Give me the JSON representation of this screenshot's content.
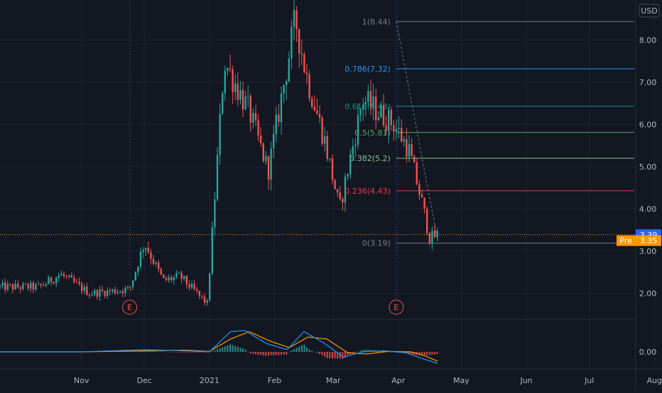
{
  "colors": {
    "background": "#131722",
    "axis_text": "#b2b5be",
    "grid": "#1f2330",
    "up": "#26a69a",
    "down": "#ef5350",
    "macd_line": "#2196f3",
    "signal_line": "#ff9800",
    "last_price_label": "#2962ff",
    "premarket_label": "#ff9800",
    "event_marker": "#ef5350"
  },
  "chart_data": [
    {
      "type": "candlestick",
      "title": "",
      "currency": "USD",
      "x_tick_labels": [
        "Nov",
        "Dec",
        "2021",
        "Feb",
        "Mar",
        "Apr",
        "May",
        "Jun",
        "Jul",
        "Aug"
      ],
      "y_tick_labels": [
        "2.00",
        "3.00",
        "4.00",
        "5.00",
        "6.00",
        "7.00",
        "8.00"
      ],
      "ylim": [
        1.35,
        8.85
      ],
      "grid": true,
      "ohlc_key_points": [
        {
          "date": "2020-10-12",
          "close": 2.15
        },
        {
          "date": "2020-10-22",
          "close": 2.45
        },
        {
          "date": "2020-11-05",
          "close": 2.0
        },
        {
          "date": "2020-11-24",
          "close": 2.1
        },
        {
          "date": "2020-12-01",
          "close": 3.2
        },
        {
          "date": "2020-12-10",
          "close": 2.3
        },
        {
          "date": "2020-12-18",
          "close": 2.4
        },
        {
          "date": "2020-12-31",
          "close": 1.75
        },
        {
          "date": "2021-01-08",
          "close": 7.5
        },
        {
          "date": "2021-01-20",
          "close": 6.3
        },
        {
          "date": "2021-01-29",
          "close": 4.9
        },
        {
          "date": "2021-02-11",
          "close": 8.5
        },
        {
          "date": "2021-02-16",
          "close": 7.2
        },
        {
          "date": "2021-02-25",
          "close": 5.6
        },
        {
          "date": "2021-03-04",
          "close": 4.0
        },
        {
          "date": "2021-03-15",
          "close": 6.6
        },
        {
          "date": "2021-03-30",
          "close": 6.0
        },
        {
          "date": "2021-04-06",
          "close": 5.4
        },
        {
          "date": "2021-04-12",
          "close": 4.2
        },
        {
          "date": "2021-04-16",
          "close": 3.3
        },
        {
          "date": "2021-04-20",
          "close": 3.39
        }
      ],
      "last_price": {
        "label": "3.39",
        "value": 3.39
      },
      "premarket": {
        "label": "Pre",
        "value_label": "3.35",
        "value": 3.35
      },
      "fibonacci_levels": [
        {
          "label": "1(8.44)",
          "ratio": 1,
          "value": 8.44,
          "color": "#787b86"
        },
        {
          "label": "0.786(7.32)",
          "ratio": 0.786,
          "value": 7.32,
          "color": "#2196f3"
        },
        {
          "label": "0.618(6.43)",
          "ratio": 0.618,
          "value": 6.43,
          "color": "#089981"
        },
        {
          "label": "0.5(5.81)",
          "ratio": 0.5,
          "value": 5.81,
          "color": "#4caf50"
        },
        {
          "label": "0.382(5.2)",
          "ratio": 0.382,
          "value": 5.2,
          "color": "#81c784"
        },
        {
          "label": "0.236(4.43)",
          "ratio": 0.236,
          "value": 4.43,
          "color": "#f23645"
        },
        {
          "label": "0(3.19)",
          "ratio": 0,
          "value": 3.19,
          "color": "#787b86"
        }
      ],
      "event_markers": [
        {
          "label": "E",
          "date": "2020-11-24"
        },
        {
          "label": "E",
          "date": "2021-03-31"
        }
      ]
    },
    {
      "type": "line",
      "indicator": "MACD",
      "y_tick_labels": [
        "0.00"
      ],
      "series": [
        {
          "role": "macd",
          "color": "#2196f3",
          "x": [
            "2020-10-01",
            "2020-11-01",
            "2020-12-01",
            "2020-12-20",
            "2021-01-01",
            "2021-01-11",
            "2021-01-18",
            "2021-01-28",
            "2021-02-07",
            "2021-02-15",
            "2021-02-24",
            "2021-03-06",
            "2021-03-15",
            "2021-03-25",
            "2021-04-05",
            "2021-04-12",
            "2021-04-20"
          ],
          "values": [
            0.0,
            0.0,
            0.1,
            0.05,
            0.0,
            0.95,
            1.0,
            0.4,
            0.1,
            0.95,
            0.45,
            -0.25,
            0.0,
            0.05,
            -0.05,
            -0.3,
            -0.55
          ]
        },
        {
          "role": "signal",
          "color": "#ff9800",
          "x": [
            "2020-10-01",
            "2020-11-01",
            "2020-12-01",
            "2020-12-20",
            "2021-01-01",
            "2021-01-11",
            "2021-01-20",
            "2021-01-30",
            "2021-02-08",
            "2021-02-17",
            "2021-02-26",
            "2021-03-08",
            "2021-03-17",
            "2021-03-27",
            "2021-04-07",
            "2021-04-14",
            "2021-04-20"
          ],
          "values": [
            0.0,
            0.0,
            0.05,
            0.08,
            0.02,
            0.6,
            0.95,
            0.5,
            0.2,
            0.7,
            0.6,
            -0.05,
            -0.1,
            0.02,
            0.0,
            -0.2,
            -0.45
          ]
        }
      ],
      "ylim": [
        -0.75,
        1.35
      ]
    }
  ]
}
